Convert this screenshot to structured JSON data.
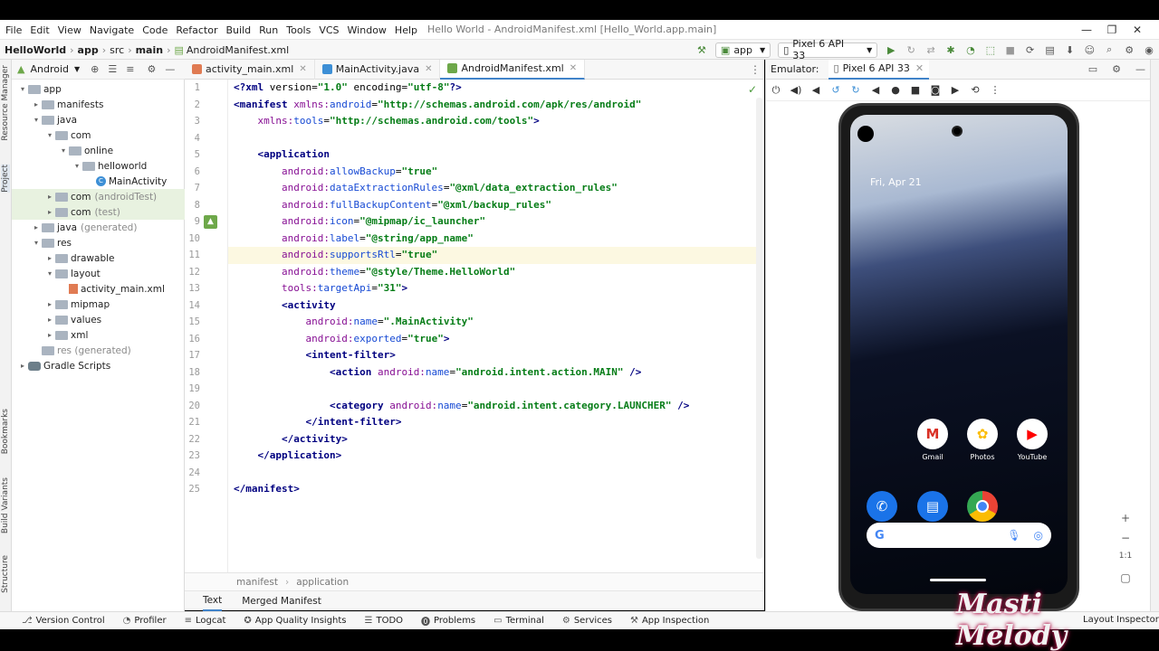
{
  "menu": [
    "File",
    "Edit",
    "View",
    "Navigate",
    "Code",
    "Refactor",
    "Build",
    "Run",
    "Tools",
    "VCS",
    "Window",
    "Help"
  ],
  "window_title": "Hello World - AndroidManifest.xml [Hello_World.app.main]",
  "breadcrumbs": [
    "HelloWorld",
    "app",
    "src",
    "main",
    "AndroidManifest.xml"
  ],
  "run_config": "app",
  "device": "Pixel 6 API 33",
  "project_view": "Android",
  "tree": [
    {
      "label": "app",
      "indent": 0,
      "arrow": "▾",
      "icon": "folder"
    },
    {
      "label": "manifests",
      "indent": 1,
      "arrow": "▸",
      "icon": "folder"
    },
    {
      "label": "java",
      "indent": 1,
      "arrow": "▾",
      "icon": "folder"
    },
    {
      "label": "com",
      "indent": 2,
      "arrow": "▾",
      "icon": "folder"
    },
    {
      "label": "online",
      "indent": 3,
      "arrow": "▾",
      "icon": "folder"
    },
    {
      "label": "helloworld",
      "indent": 4,
      "arrow": "▾",
      "icon": "folder"
    },
    {
      "label": "MainActivity",
      "indent": 5,
      "arrow": "",
      "icon": "class"
    },
    {
      "label": "com",
      "suffix": "(androidTest)",
      "indent": 2,
      "arrow": "▸",
      "icon": "folder",
      "hl": true
    },
    {
      "label": "com",
      "suffix": "(test)",
      "indent": 2,
      "arrow": "▸",
      "icon": "folder",
      "hl": true
    },
    {
      "label": "java",
      "suffix": "(generated)",
      "indent": 1,
      "arrow": "▸",
      "icon": "folder"
    },
    {
      "label": "res",
      "indent": 1,
      "arrow": "▾",
      "icon": "folder"
    },
    {
      "label": "drawable",
      "indent": 2,
      "arrow": "▸",
      "icon": "folder"
    },
    {
      "label": "layout",
      "indent": 2,
      "arrow": "▾",
      "icon": "folder"
    },
    {
      "label": "activity_main.xml",
      "indent": 3,
      "arrow": "",
      "icon": "xml"
    },
    {
      "label": "mipmap",
      "indent": 2,
      "arrow": "▸",
      "icon": "folder"
    },
    {
      "label": "values",
      "indent": 2,
      "arrow": "▸",
      "icon": "folder"
    },
    {
      "label": "xml",
      "indent": 2,
      "arrow": "▸",
      "icon": "folder"
    },
    {
      "label": "res (generated)",
      "indent": 1,
      "arrow": "",
      "icon": "folder",
      "gray": true
    },
    {
      "label": "Gradle Scripts",
      "indent": 0,
      "arrow": "▸",
      "icon": "gradle"
    }
  ],
  "tabs": [
    {
      "label": "activity_main.xml",
      "color": "#e07b53",
      "active": false
    },
    {
      "label": "MainActivity.java",
      "color": "#3d8fd6",
      "active": false
    },
    {
      "label": "AndroidManifest.xml",
      "color": "#6ea84a",
      "active": true
    }
  ],
  "code_lines": [
    "<?xml version=\"1.0\" encoding=\"utf-8\"?>",
    "<manifest xmlns:android=\"http://schemas.android.com/apk/res/android\"",
    "    xmlns:tools=\"http://schemas.android.com/tools\">",
    "",
    "    <application",
    "        android:allowBackup=\"true\"",
    "        android:dataExtractionRules=\"@xml/data_extraction_rules\"",
    "        android:fullBackupContent=\"@xml/backup_rules\"",
    "        android:icon=\"@mipmap/ic_launcher\"",
    "        android:label=\"@string/app_name\"",
    "        android:supportsRtl=\"true\"",
    "        android:theme=\"@style/Theme.HelloWorld\"",
    "        tools:targetApi=\"31\">",
    "        <activity",
    "            android:name=\".MainActivity\"",
    "            android:exported=\"true\">",
    "            <intent-filter>",
    "                <action android:name=\"android.intent.action.MAIN\" />",
    "",
    "                <category android:name=\"android.intent.category.LAUNCHER\" />",
    "            </intent-filter>",
    "        </activity>",
    "    </application>",
    "",
    "</manifest>"
  ],
  "current_line": 11,
  "editor_breadcrumb": [
    "manifest",
    "application"
  ],
  "mode_tabs": [
    "Text",
    "Merged Manifest"
  ],
  "emulator": {
    "label": "Emulator:",
    "tab": "Pixel 6 API 33",
    "date": "Fri, Apr 21",
    "apps_row1": [
      "Gmail",
      "Photos",
      "YouTube"
    ]
  },
  "left_stripe": [
    "Resource Manager",
    "Project",
    "Bookmarks",
    "Build Variants",
    "Structure"
  ],
  "bottom_tools": [
    "Version Control",
    "Profiler",
    "Logcat",
    "App Quality Insights",
    "TODO",
    "Problems",
    "Terminal",
    "Services",
    "App Inspection"
  ],
  "layout_inspector": "Layout Inspector",
  "watermark": "Masti Melody",
  "zoom": [
    "+",
    "−",
    "1:1"
  ],
  "colors": {
    "accent": "#4083c9",
    "run_green": "#4a8a3a"
  }
}
